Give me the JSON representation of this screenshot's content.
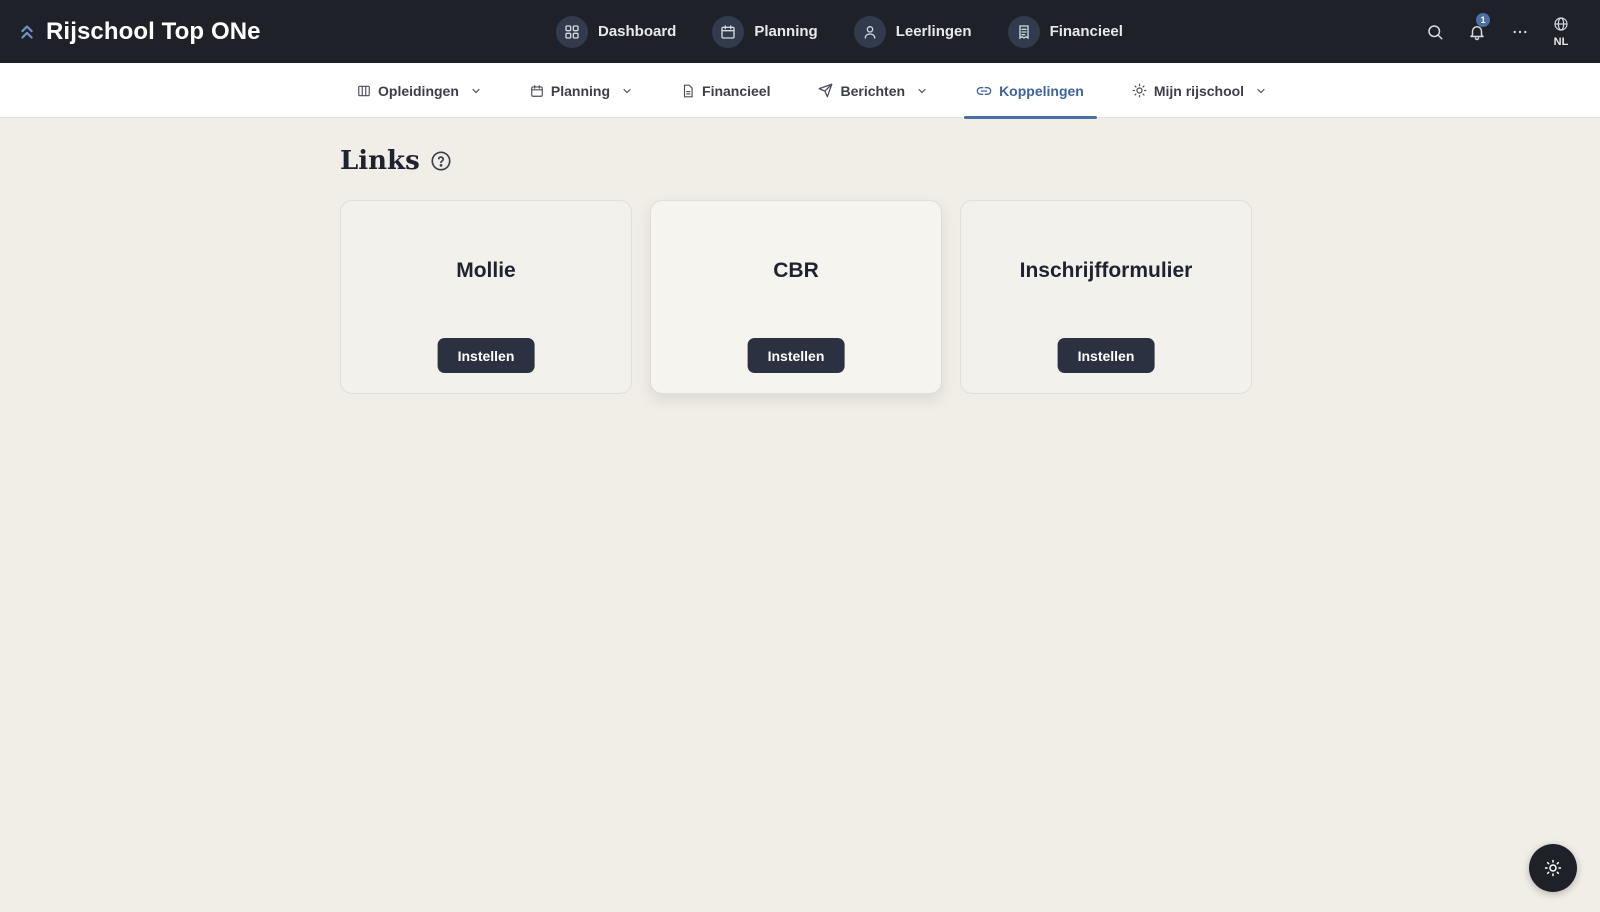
{
  "app": {
    "title": "Rijschool Top ONe",
    "logo_icon": "chevrons-up-icon"
  },
  "main_nav": [
    {
      "label": "Dashboard",
      "icon": "grid-icon"
    },
    {
      "label": "Planning",
      "icon": "calendar-icon"
    },
    {
      "label": "Leerlingen",
      "icon": "user-icon"
    },
    {
      "label": "Financieel",
      "icon": "receipt-icon"
    }
  ],
  "top_actions": {
    "search_icon": "search-icon",
    "notifications_icon": "bell-icon",
    "notification_count": "1",
    "more_icon": "more-horizontal-icon",
    "language_icon": "globe-icon",
    "language": "NL"
  },
  "sub_nav": [
    {
      "label": "Opleidingen",
      "icon": "columns-icon",
      "has_dropdown": true
    },
    {
      "label": "Planning",
      "icon": "calendar-icon",
      "has_dropdown": true
    },
    {
      "label": "Financieel",
      "icon": "document-icon",
      "has_dropdown": false
    },
    {
      "label": "Berichten",
      "icon": "send-icon",
      "has_dropdown": true
    },
    {
      "label": "Koppelingen",
      "icon": "link-icon",
      "has_dropdown": false,
      "active": true
    },
    {
      "label": "Mijn rijschool",
      "icon": "sun-icon",
      "has_dropdown": true
    }
  ],
  "page": {
    "title": "Links",
    "help_icon": "help-circle-icon"
  },
  "cards": [
    {
      "title": "Mollie",
      "button": "Instellen"
    },
    {
      "title": "CBR",
      "button": "Instellen"
    },
    {
      "title": "Inschrijfformulier",
      "button": "Instellen"
    }
  ],
  "fab": {
    "icon": "sun-icon"
  },
  "colors": {
    "topbar": "#1e2128",
    "background": "#f1eee7",
    "accent": "#4a6fa5",
    "button": "#2b3140"
  }
}
